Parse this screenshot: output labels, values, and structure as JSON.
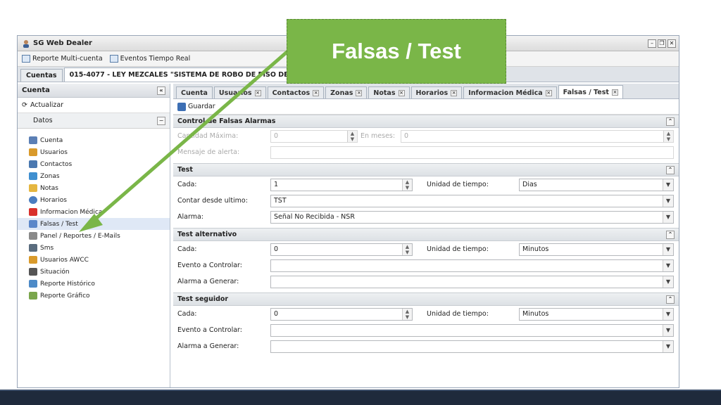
{
  "window": {
    "title": "SG Web Dealer"
  },
  "toolbar": {
    "items": [
      "Reporte Multi-cuenta",
      "Eventos Tiempo Real"
    ]
  },
  "main_tabs": [
    {
      "label": "Cuentas"
    },
    {
      "label": "015-4077 - LEY MEZCALES \"SISTEMA DE ROBO DE PISO DE VENTA"
    }
  ],
  "sidebar": {
    "header": "Cuenta",
    "refresh": "Actualizar",
    "section": "Datos",
    "items": [
      {
        "label": "Cuenta",
        "icon": "card-icon",
        "color": "#5b7fb5"
      },
      {
        "label": "Usuarios",
        "icon": "users-icon",
        "color": "#d99a2b"
      },
      {
        "label": "Contactos",
        "icon": "contacts-icon",
        "color": "#4a78b0"
      },
      {
        "label": "Zonas",
        "icon": "zones-icon",
        "color": "#3f8fd0"
      },
      {
        "label": "Notas",
        "icon": "notes-icon",
        "color": "#e5b640"
      },
      {
        "label": "Horarios",
        "icon": "clock-icon",
        "color": "#4a7dc0"
      },
      {
        "label": "Informacion Médica",
        "icon": "medical-icon",
        "color": "#d9302b"
      },
      {
        "label": "Falsas / Test",
        "icon": "wrench-icon",
        "color": "#5b87c9"
      },
      {
        "label": "Panel / Reportes / E-Mails",
        "icon": "tool-icon",
        "color": "#8a8a8a"
      },
      {
        "label": "Sms",
        "icon": "phone-icon",
        "color": "#5a6c7e"
      },
      {
        "label": "Usuarios AWCC",
        "icon": "users-icon",
        "color": "#d99a2b"
      },
      {
        "label": "Situación",
        "icon": "building-icon",
        "color": "#555555"
      },
      {
        "label": "Reporte Histórico",
        "icon": "chart-icon",
        "color": "#4d8ac7"
      },
      {
        "label": "Reporte Gráfico",
        "icon": "grid-icon",
        "color": "#7aa64c"
      }
    ]
  },
  "sub_tabs": [
    {
      "label": "Cuenta"
    },
    {
      "label": "Usuarios"
    },
    {
      "label": "Contactos"
    },
    {
      "label": "Zonas"
    },
    {
      "label": "Notas"
    },
    {
      "label": "Horarios"
    },
    {
      "label": "Informacion Médica"
    },
    {
      "label": "Falsas / Test"
    }
  ],
  "save_label": "Guardar",
  "sections": {
    "alarmas": {
      "title": "Control de Falsas Alarmas",
      "max_label": "Cantidad Máxima:",
      "max_value": "0",
      "months_label": "En meses:",
      "months_value": "0",
      "msg_label": "Mensaje de alerta:",
      "msg_value": ""
    },
    "test": {
      "title": "Test",
      "cada_label": "Cada:",
      "cada_value": "1",
      "unidad_label": "Unidad de tiempo:",
      "unidad_value": "Dias",
      "contar_label": "Contar desde ultimo:",
      "contar_value": "TST",
      "alarma_label": "Alarma:",
      "alarma_value": "Señal No Recibida - NSR"
    },
    "alternativo": {
      "title": "Test alternativo",
      "cada_label": "Cada:",
      "cada_value": "0",
      "unidad_label": "Unidad de tiempo:",
      "unidad_value": "Minutos",
      "evento_label": "Evento a Controlar:",
      "evento_value": "",
      "alarma_label": "Alarma a Generar:",
      "alarma_value": ""
    },
    "seguidor": {
      "title": "Test seguidor",
      "cada_label": "Cada:",
      "cada_value": "0",
      "unidad_label": "Unidad de tiempo:",
      "unidad_value": "Minutos",
      "evento_label": "Evento a Controlar:",
      "evento_value": "",
      "alarma_label": "Alarma a Generar:",
      "alarma_value": ""
    }
  },
  "banner": {
    "text": "Falsas / Test",
    "color": "#7ab648"
  }
}
